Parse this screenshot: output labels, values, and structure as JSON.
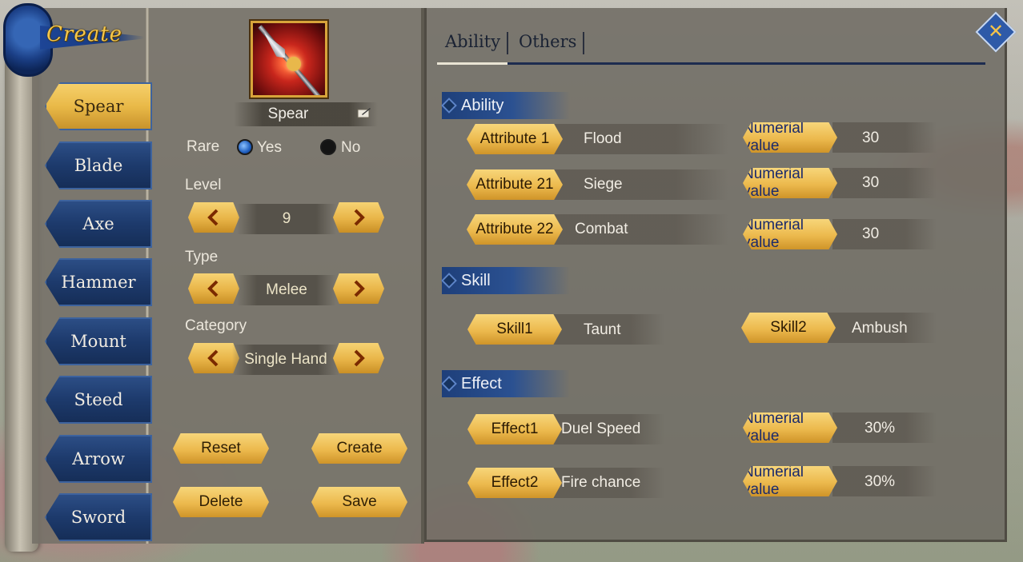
{
  "emblem": {
    "title": "Create"
  },
  "categories": [
    {
      "label": "Spear",
      "active": true
    },
    {
      "label": "Blade",
      "active": false
    },
    {
      "label": "Axe",
      "active": false
    },
    {
      "label": "Hammer",
      "active": false
    },
    {
      "label": "Mount",
      "active": false
    },
    {
      "label": "Steed",
      "active": false
    },
    {
      "label": "Arrow",
      "active": false
    },
    {
      "label": "Sword",
      "active": false
    }
  ],
  "editor": {
    "weapon_name": "Spear",
    "rare_label": "Rare",
    "rare_yes": "Yes",
    "rare_no": "No",
    "rare_selected": "Yes",
    "level_label": "Level",
    "level_value": "9",
    "type_label": "Type",
    "type_value": "Melee",
    "category_label": "Category",
    "category_value": "Single Hand",
    "buttons": {
      "reset": "Reset",
      "create": "Create",
      "delete": "Delete",
      "save": "Save"
    }
  },
  "tabs": [
    {
      "label": "Ability",
      "active": true
    },
    {
      "label": "Others",
      "active": false
    }
  ],
  "sections": {
    "ability": {
      "title": "Ability",
      "rows": [
        {
          "attr": "Attribute 1",
          "value": "Flood",
          "num_label": "Numerial value",
          "num": "30"
        },
        {
          "attr": "Attribute 21",
          "value": "Siege",
          "num_label": "Numerial value",
          "num": "30"
        },
        {
          "attr": "Attribute 22",
          "value": "Combat",
          "num_label": "Numerial value",
          "num": "30"
        }
      ]
    },
    "skill": {
      "title": "Skill",
      "rows": [
        {
          "label": "Skill1",
          "value": "Taunt"
        },
        {
          "label": "Skill2",
          "value": "Ambush"
        }
      ]
    },
    "effect": {
      "title": "Effect",
      "rows": [
        {
          "label": "Effect1",
          "value": "Duel Speed",
          "num_label": "Numerial value",
          "num": "30%"
        },
        {
          "label": "Effect2",
          "value": "Fire chance",
          "num_label": "Numerial value",
          "num": "30%"
        }
      ]
    }
  },
  "colors": {
    "gold": "#ecb94d",
    "navy": "#1d3a6c",
    "panel": "#76716a"
  }
}
